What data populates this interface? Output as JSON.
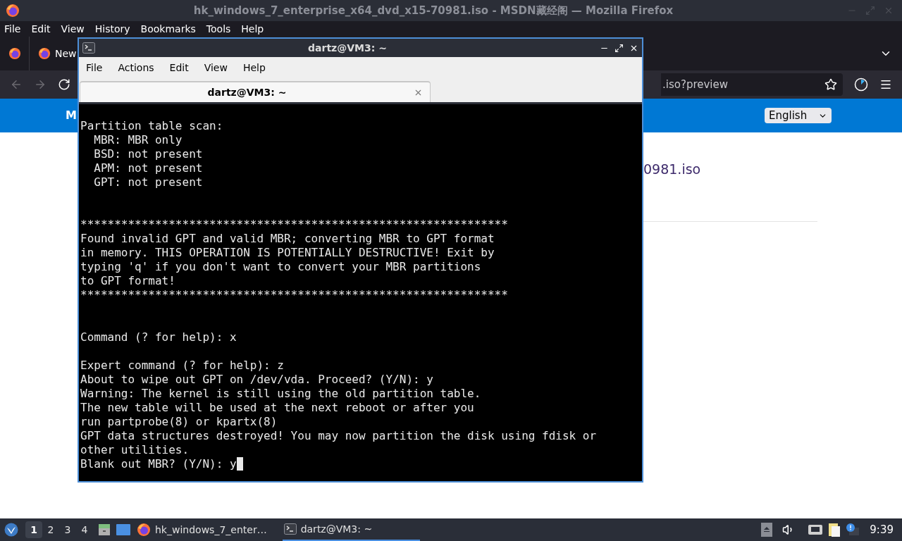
{
  "firefox": {
    "title": "hk_windows_7_enterprise_x64_dvd_x15-70981.iso - MSDN藏经阁 — Mozilla Firefox",
    "menu": [
      "File",
      "Edit",
      "View",
      "History",
      "Bookmarks",
      "Tools",
      "Help"
    ],
    "tabs": [
      {
        "label": "New"
      }
    ],
    "url": ".iso?preview",
    "page": {
      "header_text": "M",
      "language": "English",
      "link": "0981.iso"
    }
  },
  "terminal": {
    "title": "dartz@VM3: ~",
    "menu": [
      "File",
      "Actions",
      "Edit",
      "View",
      "Help"
    ],
    "tabs": [
      {
        "label": "dartz@VM3: ~",
        "selected": true
      }
    ],
    "cursor": true,
    "lines": [
      {
        "kind": "text",
        "text": "Partition table scan:"
      },
      {
        "kind": "text",
        "text": "  MBR: MBR only"
      },
      {
        "kind": "text",
        "text": "  BSD: not present"
      },
      {
        "kind": "text",
        "text": "  APM: not present"
      },
      {
        "kind": "text",
        "text": "  GPT: not present"
      },
      {
        "kind": "blank"
      },
      {
        "kind": "blank"
      },
      {
        "kind": "text",
        "text": "***************************************************************"
      },
      {
        "kind": "text",
        "text": "Found invalid GPT and valid MBR; converting MBR to GPT format"
      },
      {
        "kind": "text",
        "text": "in memory. THIS OPERATION IS POTENTIALLY DESTRUCTIVE! Exit by"
      },
      {
        "kind": "text",
        "text": "typing 'q' if you don't want to convert your MBR partitions"
      },
      {
        "kind": "text",
        "text": "to GPT format!"
      },
      {
        "kind": "text",
        "text": "***************************************************************"
      },
      {
        "kind": "blank"
      },
      {
        "kind": "blank"
      },
      {
        "kind": "text",
        "text": "Command (? for help): x"
      },
      {
        "kind": "blank"
      },
      {
        "kind": "text",
        "text": "Expert command (? for help): z"
      },
      {
        "kind": "text",
        "text": "About to wipe out GPT on /dev/vda. Proceed? (Y/N): y"
      },
      {
        "kind": "text",
        "text": "Warning: The kernel is still using the old partition table."
      },
      {
        "kind": "text",
        "text": "The new table will be used at the next reboot or after you"
      },
      {
        "kind": "text",
        "text": "run partprobe(8) or kpartx(8)"
      },
      {
        "kind": "text",
        "text": "GPT data structures destroyed! You may now partition the disk using fdisk or"
      },
      {
        "kind": "text",
        "text": "other utilities."
      },
      {
        "kind": "text",
        "text": "Blank out MBR? (Y/N): y"
      }
    ]
  },
  "taskbar": {
    "workspaces": [
      {
        "label": "1",
        "selected": true
      },
      {
        "label": "2",
        "selected": false
      },
      {
        "label": "3",
        "selected": false
      },
      {
        "label": "4",
        "selected": false
      }
    ],
    "tasks": [
      {
        "kind": "browser",
        "label": "hk_windows_7_enter…",
        "selected": false
      },
      {
        "kind": "terminal",
        "label": "dartz@VM3: ~",
        "selected": true
      }
    ],
    "clock": "9:39"
  }
}
